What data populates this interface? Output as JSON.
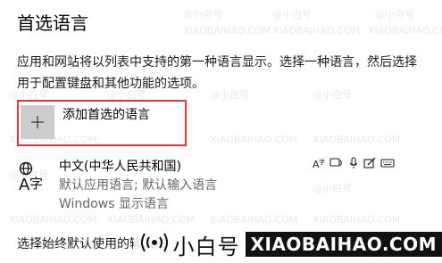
{
  "section": {
    "title": "首选语言",
    "description": "应用和网站将以列表中支持的第一种语言显示。选择一种语言，然后选择用于配置键盘和其他功能的选项。"
  },
  "add_language": {
    "label": "添加首选的语言",
    "icon": "plus-icon"
  },
  "language": {
    "name": "中文(中华人民共和国)",
    "detail_1": "默认应用语言; 默认输入语言",
    "detail_2": "Windows 显示语言",
    "icon": "language-icon",
    "features": [
      "language-pack-icon",
      "text-to-speech-icon",
      "speech-recognition-icon",
      "handwriting-icon",
      "keyboard-icon"
    ]
  },
  "bottom": {
    "text": "选择始终默认使用的输入法"
  },
  "watermark": {
    "handle": "@小白号",
    "url": "XIAOBAIHAO.COM",
    "brand_cn": "小白号",
    "brand_en": "XIAOBAIHAO.COM"
  },
  "colors": {
    "highlight_border": "#d9363e",
    "plus_tile": "#cccccc"
  }
}
